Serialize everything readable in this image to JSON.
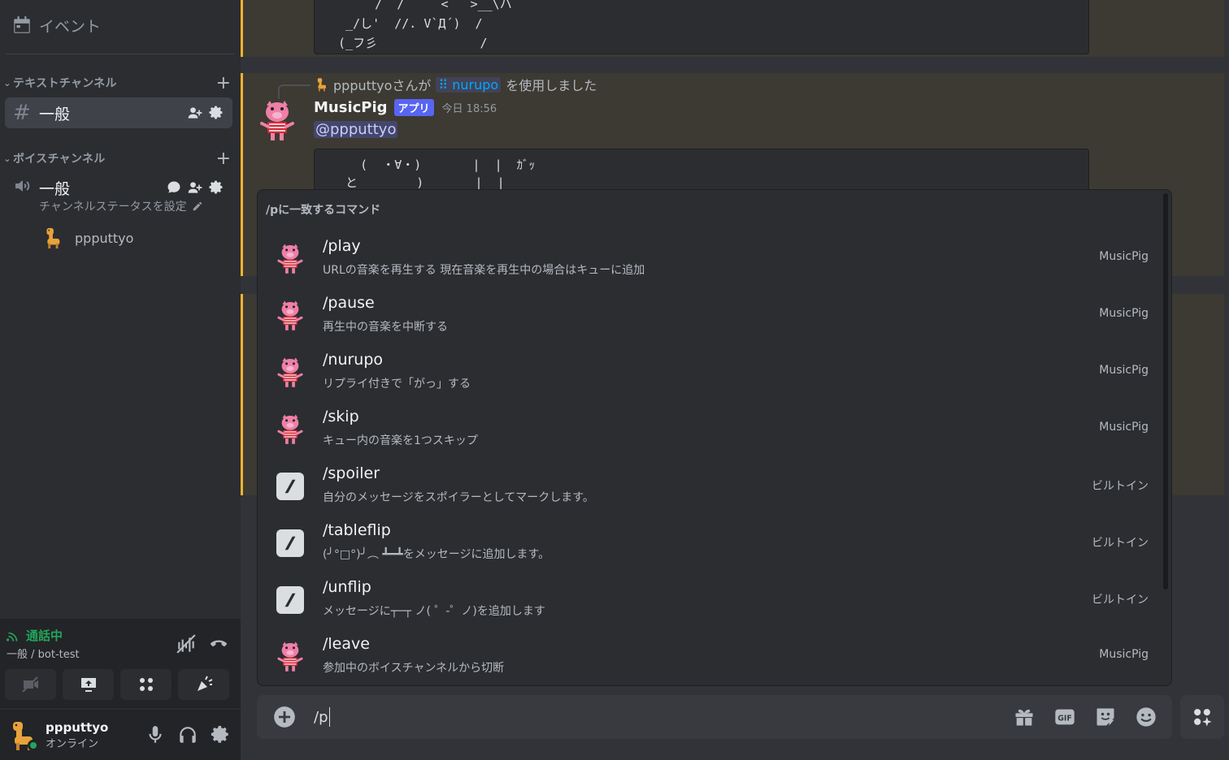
{
  "sidebar": {
    "events_label": "イベント",
    "text_category": "テキストチャンネル",
    "text_channel": "一般",
    "voice_category": "ボイスチャンネル",
    "voice_channel": "一般",
    "voice_status": "チャンネルステータスを設定",
    "voice_user": "ppputtyo"
  },
  "voice_panel": {
    "status": "通話中",
    "channel": "一般 / bot-test"
  },
  "user_panel": {
    "name": "ppputtyo",
    "status": "オンライン"
  },
  "chat": {
    "codeblock_top": "      /  /     <   >__\\ハ\n  _/し'  //. V`Д´)  /\n (_フ彡              /",
    "reply_user": "ppputtyoさんが",
    "reply_command": "nurupo",
    "reply_suffix": "を使用しました",
    "author": "MusicPig",
    "app_tag": "アプリ",
    "time": "今日 18:56",
    "mention": "@ppputtyo",
    "codeblock_bottom": "    (  ・∀・)       |  |  ｶﾞｯ\n  と        )       |  |"
  },
  "autocomplete": {
    "header": "/pに一致するコマンド",
    "items": [
      {
        "name": "/play",
        "desc": "URLの音楽を再生する 現在音楽を再生中の場合はキューに追加",
        "source": "MusicPig",
        "icon": "musicpig-avatar"
      },
      {
        "name": "/pause",
        "desc": "再生中の音楽を中断する",
        "source": "MusicPig",
        "icon": "musicpig-avatar"
      },
      {
        "name": "/nurupo",
        "desc": "リプライ付きで「がっ」する",
        "source": "MusicPig",
        "icon": "musicpig-avatar"
      },
      {
        "name": "/skip",
        "desc": "キュー内の音楽を1つスキップ",
        "source": "MusicPig",
        "icon": "musicpig-avatar"
      },
      {
        "name": "/spoiler",
        "desc": "自分のメッセージをスポイラーとしてマークします。",
        "source": "ビルトイン",
        "icon": "slash-icon"
      },
      {
        "name": "/tableflip",
        "desc": "(╯°□°)╯︵ ┻━┻をメッセージに追加します。",
        "source": "ビルトイン",
        "icon": "slash-icon"
      },
      {
        "name": "/unflip",
        "desc": "メッセージに┬─┬ ノ( ゜-゜ノ)を追加します",
        "source": "ビルトイン",
        "icon": "slash-icon"
      },
      {
        "name": "/leave",
        "desc": "参加中のボイスチャンネルから切断",
        "source": "MusicPig",
        "icon": "musicpig-avatar"
      }
    ]
  },
  "input": {
    "value": "/p"
  },
  "colors": {
    "accent": "#5865f2",
    "online": "#23a55a",
    "highlight_border": "#f0b232",
    "link": "#00a8fc"
  }
}
